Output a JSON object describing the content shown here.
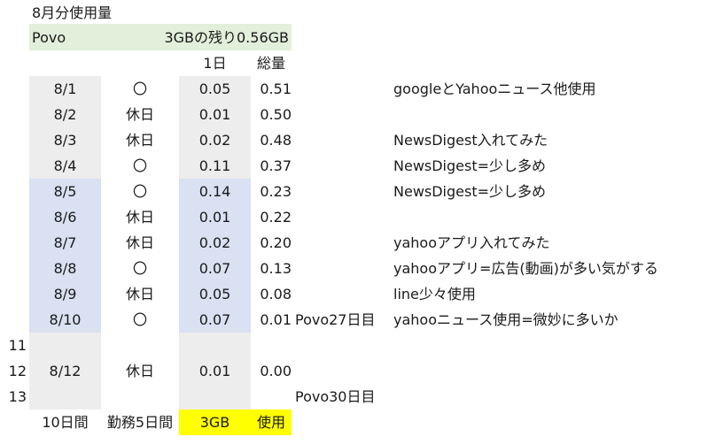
{
  "title": "8月分使用量",
  "header": {
    "carrier": "Povo",
    "remaining": "3GBの残り0.56GB",
    "col_daily": "1日",
    "col_total": "総量"
  },
  "rows": [
    {
      "date": "8/1",
      "day": "〇",
      "daily": "0.05",
      "total": "0.51",
      "note1": "",
      "note2": "googleとYahooニュース他使用"
    },
    {
      "date": "8/2",
      "day": "休日",
      "daily": "0.01",
      "total": "0.50",
      "note1": "",
      "note2": ""
    },
    {
      "date": "8/3",
      "day": "休日",
      "daily": "0.02",
      "total": "0.48",
      "note1": "",
      "note2": "NewsDigest入れてみた"
    },
    {
      "date": "8/4",
      "day": "〇",
      "daily": "0.11",
      "total": "0.37",
      "note1": "",
      "note2": "NewsDigest=少し多め"
    },
    {
      "date": "8/5",
      "day": "〇",
      "daily": "0.14",
      "total": "0.23",
      "note1": "",
      "note2": "NewsDigest=少し多め"
    },
    {
      "date": "8/6",
      "day": "休日",
      "daily": "0.01",
      "total": "0.22",
      "note1": "",
      "note2": ""
    },
    {
      "date": "8/7",
      "day": "休日",
      "daily": "0.02",
      "total": "0.20",
      "note1": "",
      "note2": "yahooアプリ入れてみた"
    },
    {
      "date": "8/8",
      "day": "〇",
      "daily": "0.07",
      "total": "0.13",
      "note1": "",
      "note2": "yahooアプリ=広告(動画)が多い気がする"
    },
    {
      "date": "8/9",
      "day": "休日",
      "daily": "0.05",
      "total": "0.08",
      "note1": "",
      "note2": "line少々使用"
    },
    {
      "date": "8/10",
      "day": "〇",
      "daily": "0.07",
      "total": "0.01",
      "note1": "Povo27日目",
      "note2": "yahooニュース使用=微妙に多いか"
    },
    {
      "rownum": "11",
      "date": "",
      "day": "",
      "daily": "",
      "total": "",
      "note1": "",
      "note2": ""
    },
    {
      "rownum": "12",
      "date": "8/12",
      "day": "休日",
      "daily": "0.01",
      "total": "0.00",
      "note1": "",
      "note2": ""
    },
    {
      "rownum": "13",
      "date": "",
      "day": "",
      "daily": "",
      "total": "",
      "note1": "Povo30日目",
      "note2": ""
    }
  ],
  "footer": {
    "days": "10日間",
    "work": "勤務5日間",
    "amount": "3GB",
    "usage": "使用"
  },
  "colors": {
    "header_green": "#e2efda",
    "gray": "#ededed",
    "blue": "#d9e1f2",
    "yellow": "#ffff00"
  }
}
